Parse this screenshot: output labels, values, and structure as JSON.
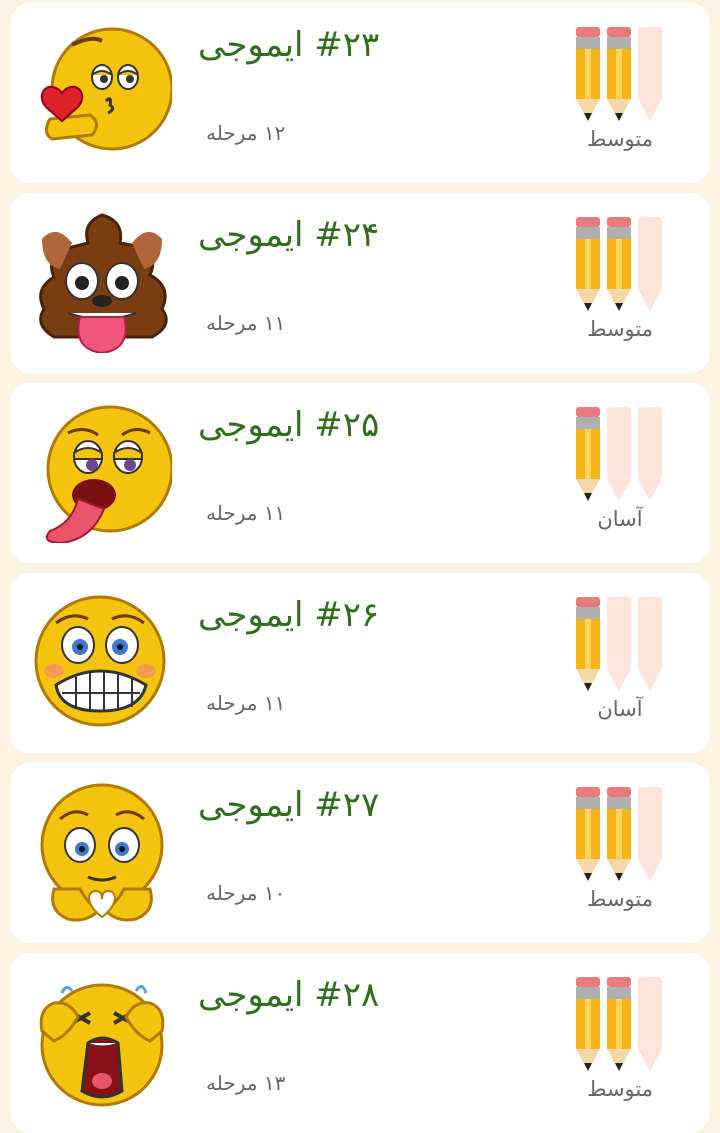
{
  "levels_list": [
    {
      "title": "#۲۳ ایموجی",
      "levels": "۱۲ مرحله",
      "difficulty": "متوسط",
      "filled": 2,
      "emoji": "kiss-emoji-icon"
    },
    {
      "title": "#۲۴ ایموجی",
      "levels": "۱۱ مرحله",
      "difficulty": "متوسط",
      "filled": 2,
      "emoji": "poop-dog-emoji-icon"
    },
    {
      "title": "#۲۵ ایموجی",
      "levels": "۱۱ مرحله",
      "difficulty": "آسان",
      "filled": 1,
      "emoji": "exhausted-tongue-emoji-icon"
    },
    {
      "title": "#۲۶ ایموجی",
      "levels": "۱۱ مرحله",
      "difficulty": "آسان",
      "filled": 1,
      "emoji": "grimace-emoji-icon"
    },
    {
      "title": "#۲۷ ایموجی",
      "levels": "۱۰ مرحله",
      "difficulty": "متوسط",
      "filled": 2,
      "emoji": "heart-hands-emoji-icon"
    },
    {
      "title": "#۲۸ ایموجی",
      "levels": "۱۳ مرحله",
      "difficulty": "متوسط",
      "filled": 2,
      "emoji": "crying-emoji-icon"
    }
  ],
  "colors": {
    "background": "#fdf3e3",
    "title": "#2f6e1c",
    "pencil_filled": "#f6b516",
    "pencil_empty": "#fde3d9"
  }
}
